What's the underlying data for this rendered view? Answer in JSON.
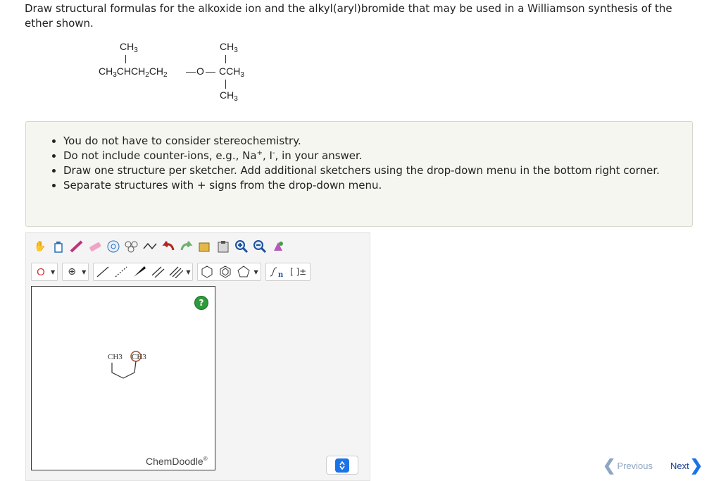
{
  "question": {
    "text": "Draw structural formulas for the alkoxide ion and the alkyl(aryl)bromide that may be used in a Williamson synthesis of the ether shown."
  },
  "formula": {
    "top_left": "CH",
    "top_right": "CH",
    "main_chain": "CH",
    "main_mid": "CHCH",
    "main_ch2": "CH",
    "oxygen": "O",
    "right_c": "CCH",
    "bottom": "CH",
    "sub3": "3",
    "sub2": "2"
  },
  "notes": {
    "items": [
      "You do not have to consider stereochemistry.",
      "Do not include counter-ions, e.g., Na",
      "Draw one structure per sketcher. Add additional sketchers using the drop-down menu in the bottom right corner.",
      "Separate structures with + signs from the drop-down menu."
    ],
    "item2_tail_comma": ", I",
    "item2_tail_end": ", in your answer.",
    "plus_sup": "+",
    "minus_sup": "-"
  },
  "sketcher": {
    "element_button": "O",
    "charge_button": "⊕",
    "help_label": "?",
    "canvas_labels": [
      "CH3",
      "CH3"
    ],
    "brand": "ChemDoodle",
    "brand_mark": "®",
    "add_select_knob": "▲▼"
  },
  "toolbar": {
    "row1_icons": [
      "hand-icon",
      "eraser-bottle-icon",
      "pencil-icon",
      "eraser-icon",
      "ring-template-icon",
      "atom-map-icon",
      "chain-icon",
      "undo-icon",
      "redo-icon",
      "copy-icon",
      "paste-icon",
      "zoom-in-icon",
      "zoom-out-icon",
      "clean-icon"
    ],
    "row2_icons": [
      "single-bond-icon",
      "wedge-bond-icon",
      "hash-bond-icon",
      "bold-bond-icon",
      "double-bond-icon",
      "triple-bond-icon",
      "cyclohexane-icon",
      "benzene-icon",
      "pentagon-icon",
      "sgroup-icon",
      "bracket-icon"
    ],
    "bracket_label": "[ ]±",
    "sgroup_label": "n"
  },
  "navigation": {
    "previous": "Previous",
    "next": "Next",
    "previous_chevron": "❮",
    "next_chevron": "❯"
  },
  "colors": {
    "next": "#1a3d8c",
    "previous": "#8ea6c4",
    "help": "#2e9a3a",
    "select_knob": "#1a73e8"
  }
}
